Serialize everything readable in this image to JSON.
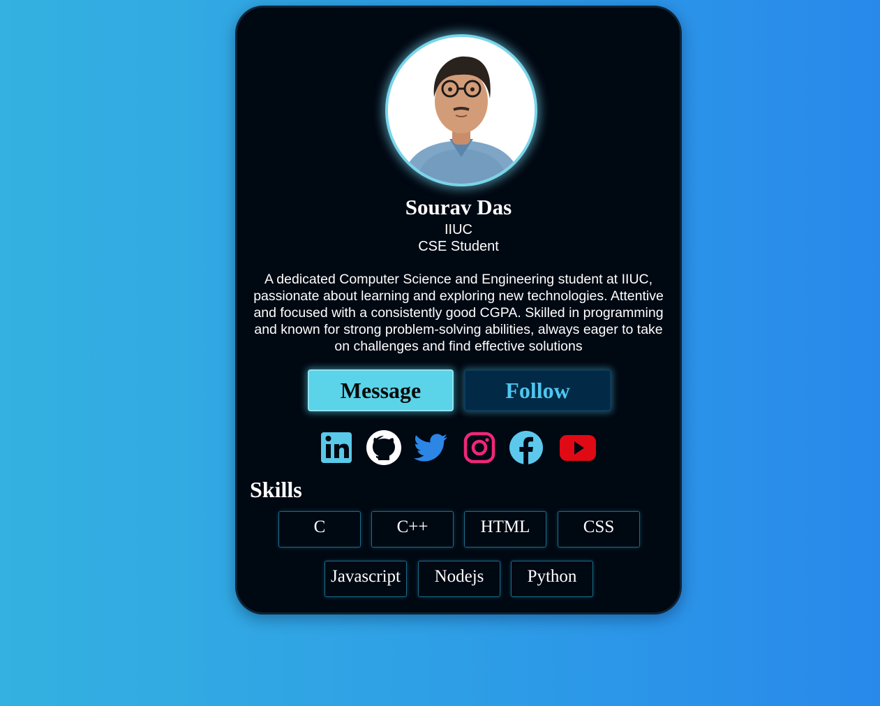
{
  "profile": {
    "name": "Sourav Das",
    "org": "IIUC",
    "role": "CSE Student",
    "bio": "A dedicated Computer Science and Engineering student at IIUC, passionate about learning and exploring new technologies. Attentive and focused with a consistently good CGPA. Skilled in programming and known for strong problem-solving abilities, always eager to take on challenges and find effective solutions"
  },
  "actions": {
    "message_label": "Message",
    "follow_label": "Follow"
  },
  "social": [
    {
      "icon": "linkedin-icon",
      "color": "#59c9e8"
    },
    {
      "icon": "github-icon",
      "color": "#ffffff"
    },
    {
      "icon": "twitter-icon",
      "color": "#2b86e6"
    },
    {
      "icon": "instagram-icon",
      "color": "#f0267a"
    },
    {
      "icon": "facebook-icon",
      "color": "#5cc8ec"
    },
    {
      "icon": "youtube-icon",
      "color": "#e00a14"
    }
  ],
  "skills": {
    "title": "Skills",
    "items": [
      "C",
      "C++",
      "HTML",
      "CSS",
      "Javascript",
      "Nodejs",
      "Python"
    ]
  },
  "colors": {
    "card_bg": "#000812",
    "accent": "#5bd3e8",
    "follow_bg": "#022a47"
  }
}
